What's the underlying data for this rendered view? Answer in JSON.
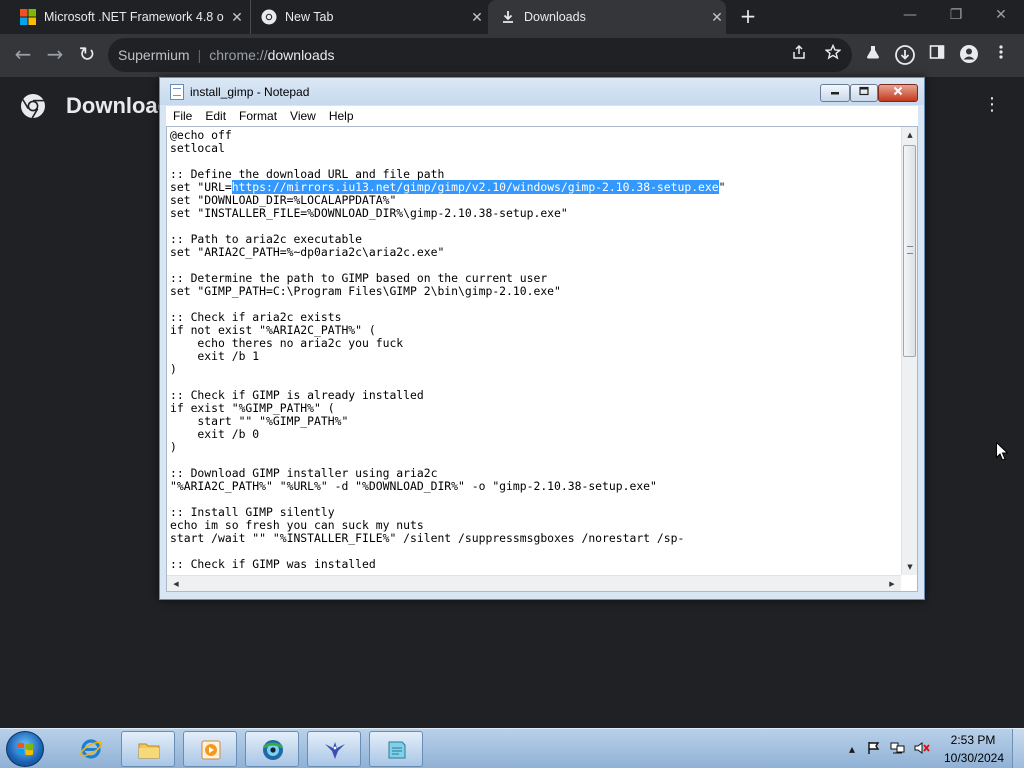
{
  "browser": {
    "tabs": [
      {
        "label": "Microsoft .NET Framework 4.8 o",
        "icon": "microsoft-icon",
        "active": false
      },
      {
        "label": "New Tab",
        "icon": "chrome-icon",
        "active": false
      },
      {
        "label": "Downloads",
        "icon": "download-icon",
        "active": true
      }
    ],
    "new_tab_symbol": "+",
    "window_controls": {
      "minimize": "—",
      "restore": "❐",
      "close": "✕"
    },
    "nav": {
      "back": "←",
      "forward": "→",
      "reload": "↻"
    },
    "omnibox": {
      "site_name": "Supermium",
      "separator": "|",
      "scheme": "chrome://",
      "path": "downloads"
    },
    "toolbar_icons": [
      "share-icon",
      "bookmark-star-icon",
      "labs-flask-icon",
      "downloads-icon",
      "side-panel-icon",
      "profile-icon",
      "kebab-menu-icon"
    ]
  },
  "downloads_page": {
    "title": "Downloads",
    "menu_symbol": "⋮"
  },
  "notepad": {
    "title": "install_gimp - Notepad",
    "menus": [
      "File",
      "Edit",
      "Format",
      "View",
      "Help"
    ],
    "lines": [
      "@echo off",
      "setlocal",
      "",
      ":: Define the download URL and file path",
      "set \"URL=https://mirrors.iu13.net/gimp/gimp/v2.10/windows/gimp-2.10.38-setup.exe\"",
      "set \"DOWNLOAD_DIR=%LOCALAPPDATA%\"",
      "set \"INSTALLER_FILE=%DOWNLOAD_DIR%\\gimp-2.10.38-setup.exe\"",
      "",
      ":: Path to aria2c executable",
      "set \"ARIA2C_PATH=%~dp0aria2c\\aria2c.exe\"",
      "",
      ":: Determine the path to GIMP based on the current user",
      "set \"GIMP_PATH=C:\\Program Files\\GIMP 2\\bin\\gimp-2.10.exe\"",
      "",
      ":: Check if aria2c exists",
      "if not exist \"%ARIA2C_PATH%\" (",
      "    echo theres no aria2c you fuck",
      "    exit /b 1",
      ")",
      "",
      ":: Check if GIMP is already installed",
      "if exist \"%GIMP_PATH%\" (",
      "    start \"\" \"%GIMP_PATH%\"",
      "    exit /b 0",
      ")",
      "",
      ":: Download GIMP installer using aria2c",
      "\"%ARIA2C_PATH%\" \"%URL%\" -d \"%DOWNLOAD_DIR%\" -o \"gimp-2.10.38-setup.exe\"",
      "",
      ":: Install GIMP silently",
      "echo im so fresh you can suck my nuts",
      "start /wait \"\" \"%INSTALLER_FILE%\" /silent /suppressmsgboxes /norestart /sp-",
      "",
      ":: Check if GIMP was installed"
    ],
    "selected_text": "https://mirrors.iu13.net/gimp/gimp/v2.10/windows/gimp-2.10.38-setup.exe",
    "selection_line_index": 4
  },
  "taskbar": {
    "apps": [
      {
        "name": "internet-explorer",
        "icon": "internet-explorer-icon",
        "running": false
      },
      {
        "name": "file-explorer",
        "icon": "folder-icon",
        "running": true
      },
      {
        "name": "media-player",
        "icon": "media-player-icon",
        "running": true
      },
      {
        "name": "supermium-browser",
        "icon": "globe-icon",
        "running": true
      },
      {
        "name": "gimp",
        "icon": "bird-icon",
        "running": true
      },
      {
        "name": "notepad",
        "icon": "notepad-icon",
        "running": true
      }
    ],
    "tray": {
      "show_hidden": "▴",
      "time": "2:53 PM",
      "date": "10/30/2024"
    }
  }
}
